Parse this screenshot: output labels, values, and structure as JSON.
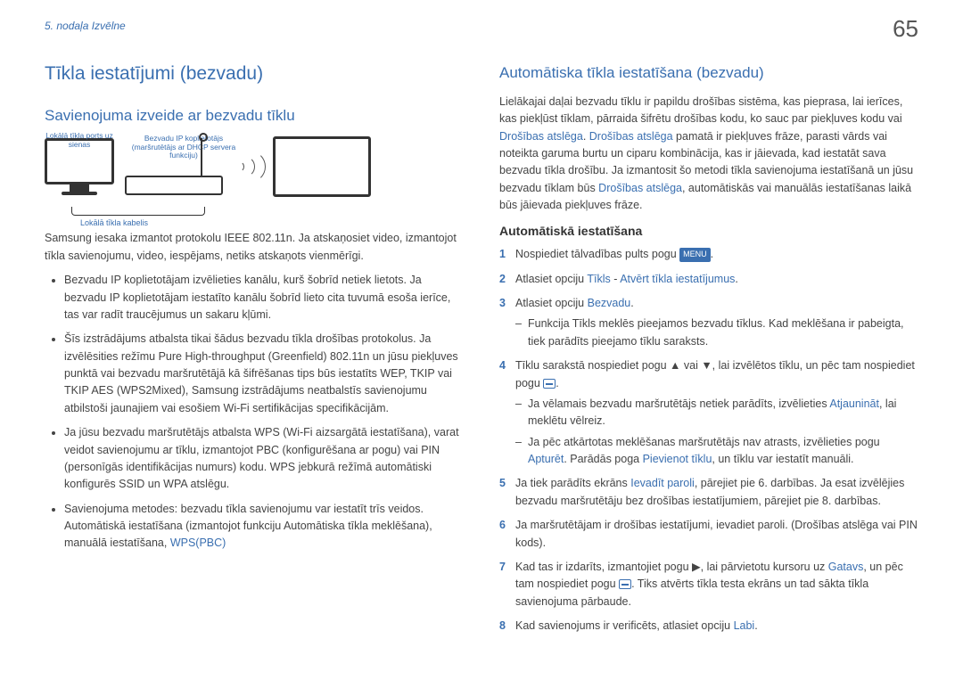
{
  "page_number": "65",
  "breadcrumb": "5. nodaļa Izvēlne",
  "left": {
    "title": "Tīkla iestatījumi (bezvadu)",
    "subtitle": "Savienojuma izveide ar bezvadu tīklu",
    "diagram": {
      "ports_label": "Lokālā tīkla ports uz sienas",
      "router_label": "Bezvadu IP koplietotājs (maršrutētājs ar DHCP servera funkciju)",
      "cable_label": "Lokālā tīkla kabelis"
    },
    "intro": "Samsung iesaka izmantot protokolu IEEE 802.11n. Ja atskaņosiet video, izmantojot tīkla savienojumu, video, iespējams, netiks atskaņots vienmērīgi.",
    "bullets": [
      "Bezvadu IP koplietotājam izvēlieties kanālu, kurš šobrīd netiek lietots. Ja bezvadu IP koplietotājam iestatīto kanālu šobrīd lieto cita tuvumā esoša ierīce, tas var radīt traucējumus un sakaru kļūmi.",
      "Šīs izstrādājums atbalsta tikai šādus bezvadu tīkla drošības protokolus. Ja izvēlēsities režīmu Pure High-throughput (Greenfield) 802.11n un jūsu piekļuves punktā vai bezvadu maršrutētājā kā šifrēšanas tips būs iestatīts WEP, TKIP vai TKIP AES (WPS2Mixed), Samsung izstrādājums neatbalstīs savienojumu atbilstoši jaunajiem vai esošiem Wi-Fi sertifikācijas specifikācijām.",
      "Ja jūsu bezvadu maršrutētājs atbalsta WPS (Wi-Fi aizsargātā iestatīšana), varat veidot savienojumu ar tīklu, izmantojot PBC (konfigurēšana ar pogu) vai PIN (personīgās identifikācijas numurs) kodu. WPS jebkurā režīmā automātiski konfigurēs SSID un WPA atslēgu."
    ],
    "bullet4_a": "Savienojuma metodes: bezvadu tīkla savienojumu var iestatīt trīs veidos.",
    "bullet4_b": "Automātiskā iestatīšana (izmantojot funkciju Automātiska tīkla meklēšana), manuālā iestatīšana, ",
    "bullet4_link": "WPS(PBC)"
  },
  "right": {
    "title": "Automātiska tīkla iestatīšana (bezvadu)",
    "p1_a": "Lielākajai daļai bezvadu tīklu ir papildu drošības sistēma, kas pieprasa, lai ierīces, kas piekļūst tīklam, pārraida šifrētu drošības kodu, ko sauc par piekļuves kodu vai ",
    "p1_link": "Drošības atslēga",
    "p1_b": ". ",
    "p2_link": "Drošības atslēga",
    "p2_a": " pamatā ir piekļuves frāze, parasti vārds vai noteikta garuma burtu un ciparu kombinācija, kas ir jāievada, kad iestatāt sava bezvadu tīkla drošību. Ja izmantosit šo metodi tīkla savienojuma iestatīšanā un jūsu bezvadu tīklam būs ",
    "p2_link2": "Drošības atslēga",
    "p2_b": ", automātiskās vai manuālās iestatīšanas laikā būs jāievada piekļuves frāze.",
    "h3": "Automātiskā iestatīšana",
    "steps": {
      "s1_a": "Nospiediet tālvadības pults pogu ",
      "s1_badge": "MENU",
      "s1_b": ".",
      "s2_a": "Atlasiet opciju ",
      "s2_l1": "Tīkls",
      "s2_mid": " - ",
      "s2_l2": "Atvērt tīkla iestatījumus",
      "s2_b": ".",
      "s3_a": "Atlasiet opciju ",
      "s3_l": "Bezvadu",
      "s3_b": ".",
      "s3_sub": "Funkcija Tīkls meklēs pieejamos bezvadu tīklus. Kad meklēšana ir pabeigta, tiek parādīts pieejamo tīklu saraksts.",
      "s4_a": "Tīklu sarakstā nospiediet pogu ▲ vai ▼, lai izvēlētos tīklu, un pēc tam nospiediet pogu ",
      "s4_b": ".",
      "s4_sub1_a": "Ja vēlamais bezvadu maršrutētājs netiek parādīts, izvēlieties ",
      "s4_sub1_l": "Atjaunināt",
      "s4_sub1_b": ", lai meklētu vēlreiz.",
      "s4_sub2_a": "Ja pēc atkārtotas meklēšanas maršrutētājs nav atrasts, izvēlieties pogu ",
      "s4_sub2_l": "Apturēt",
      "s4_sub2_b": ". Parādās poga ",
      "s4_sub2_l2": "Pievienot tīklu",
      "s4_sub2_c": ", un tīklu var iestatīt manuāli.",
      "s5_a": "Ja tiek parādīts ekrāns ",
      "s5_l": "Ievadīt paroli",
      "s5_b": ", pārejiet pie 6. darbības. Ja esat izvēlējies bezvadu maršrutētāju bez drošības iestatījumiem, pārejiet pie 8. darbības.",
      "s6": "Ja maršrutētājam ir drošības iestatījumi, ievadiet paroli. (Drošības atslēga vai PIN kods).",
      "s7_a": "Kad tas ir izdarīts, izmantojiet pogu ▶, lai pārvietotu kursoru uz ",
      "s7_l": "Gatavs",
      "s7_b": ", un pēc tam nospiediet pogu ",
      "s7_c": ". Tiks atvērts tīkla testa ekrāns un tad sākta tīkla savienojuma pārbaude.",
      "s8_a": "Kad savienojums ir verificēts, atlasiet opciju ",
      "s8_l": "Labi",
      "s8_b": "."
    }
  }
}
